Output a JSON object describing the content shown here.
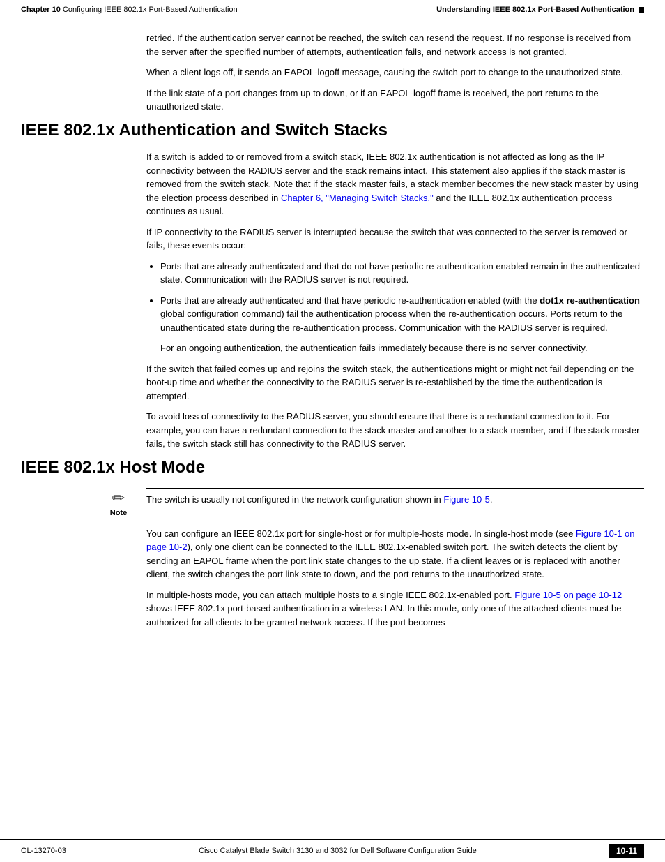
{
  "header": {
    "chapter_label": "Chapter 10",
    "chapter_title": "Configuring IEEE 802.1x Port-Based Authentication",
    "section_right": "Understanding IEEE 802.1x Port-Based Authentication",
    "black_square": "■"
  },
  "intro": {
    "para1": "retried. If the authentication server cannot be reached, the switch can resend the request. If no response is received from the server after the specified number of attempts, authentication fails, and network access is not granted.",
    "para2": "When a client logs off, it sends an EAPOL-logoff message, causing the switch port to change to the unauthorized state.",
    "para3": "If the link state of a port changes from up to down, or if an EAPOL-logoff frame is received, the port returns to the unauthorized state."
  },
  "section1": {
    "heading": "IEEE 802.1x Authentication and Switch Stacks",
    "para1": "If a switch is added to or removed from a switch stack, IEEE 802.1x authentication is not affected as long as the IP connectivity between the RADIUS server and the stack remains intact. This statement also applies if the stack master is removed from the switch stack. Note that if the stack master fails, a stack member becomes the new stack master by using the election process described in ",
    "para1_link": "Chapter 6, \"Managing Switch Stacks,\"",
    "para1_end": " and the IEEE 802.1x authentication process continues as usual.",
    "para2": "If IP connectivity to the RADIUS server is interrupted because the switch that was connected to the server is removed or fails, these events occur:",
    "bullet1": "Ports that are already authenticated and that do not have periodic re-authentication enabled remain in the authenticated state. Communication with the RADIUS server is not required.",
    "bullet2_start": "Ports that are already authenticated and that have periodic re-authentication enabled (with the ",
    "bullet2_bold1": "dot1x re-authentication",
    "bullet2_mid": " global configuration command) fail the authentication process when the re-authentication occurs. Ports return to the unauthenticated state during the re-authentication process. Communication with the RADIUS server is required.",
    "sub_para": "For an ongoing authentication, the authentication fails immediately because there is no server connectivity.",
    "para3": "If the switch that failed comes up and rejoins the switch stack, the authentications might or might not fail depending on the boot-up time and whether the connectivity to the RADIUS server is re-established by the time the authentication is attempted.",
    "para4": "To avoid loss of connectivity to the RADIUS server, you should ensure that there is a redundant connection to it. For example, you can have a redundant connection to the stack master and another to a stack member, and if the stack master fails, the switch stack still has connectivity to the RADIUS server."
  },
  "section2": {
    "heading": "IEEE 802.1x Host Mode",
    "note_text_start": "The switch is usually not configured in the network configuration shown in ",
    "note_link": "Figure 10-5",
    "note_text_end": ".",
    "para1_start": "You can configure an IEEE 802.1x port for single-host or for multiple-hosts mode. In single-host mode (see ",
    "para1_link": "Figure 10-1 on page 10-2",
    "para1_mid": "), only one client can be connected to the IEEE 802.1x-enabled switch port. The switch detects the client by sending an EAPOL frame when the port link state changes to the up state. If a client leaves or is replaced with another client, the switch changes the port link state to down, and the port returns to the unauthorized state.",
    "para2_start": "In multiple-hosts mode, you can attach multiple hosts to a single IEEE 802.1x-enabled port. ",
    "para2_link": "Figure 10-5 on page 10-12",
    "para2_mid": " shows IEEE 802.1x port-based authentication in a wireless LAN. In this mode, only one of the attached clients must be authorized for all clients to be granted network access. If the port becomes"
  },
  "footer": {
    "left": "OL-13270-03",
    "center": "Cisco Catalyst Blade Switch 3130 and 3032 for Dell Software Configuration Guide",
    "right": "10-11"
  },
  "note_label": "Note"
}
